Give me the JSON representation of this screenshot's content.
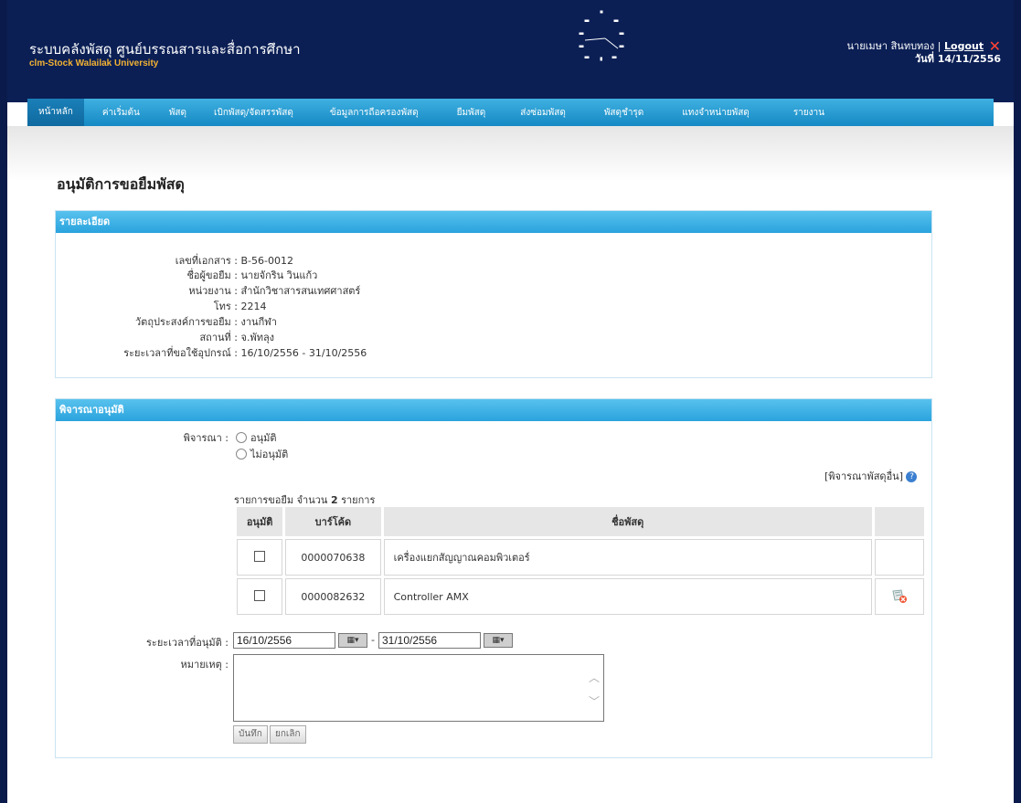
{
  "header": {
    "site_title": "ระบบคลังพัสดุ ศูนย์บรรณสารและสื่อการศึกษา",
    "site_subtitle": "clm-Stock Walailak University",
    "user_name": "นายเมษา สินทบทอง |",
    "logout_label": "Logout",
    "date_label": "วันที่ 14/11/2556"
  },
  "nav": {
    "items": [
      {
        "label": "หน้าหลัก"
      },
      {
        "label": "ค่าเริ่มต้น"
      },
      {
        "label": "พัสดุ"
      },
      {
        "label": "เบิกพัสดุ/จัดสรรพัสดุ"
      },
      {
        "label": "ข้อมูลการถือครองพัสดุ"
      },
      {
        "label": "ยืมพัสดุ"
      },
      {
        "label": "ส่งซ่อมพัสดุ"
      },
      {
        "label": "พัสดุชำรุด"
      },
      {
        "label": "แทงจำหน่ายพัสดุ"
      },
      {
        "label": "รายงาน"
      }
    ]
  },
  "page": {
    "title": "อนุมัติการขอยืมพัสดุ"
  },
  "details": {
    "panel_title": "รายละเอียด",
    "rows": [
      {
        "label": "เลขที่เอกสาร :",
        "value": "B-56-0012"
      },
      {
        "label": "ชื่อผู้ขอยืม :",
        "value": "นายจักริน วินแก้ว"
      },
      {
        "label": "หน่วยงาน :",
        "value": "สำนักวิชาสารสนเทศศาสตร์"
      },
      {
        "label": "โทร :",
        "value": "2214"
      },
      {
        "label": "วัตถุประสงค์การขอยืม :",
        "value": "งานกีฬา"
      },
      {
        "label": "สถานที่ :",
        "value": "จ.พัทลุง"
      },
      {
        "label": "ระยะเวลาที่ขอใช้อุปกรณ์ :",
        "value": "16/10/2556 - 31/10/2556"
      }
    ]
  },
  "approval": {
    "panel_title": "พิจารณาอนุมัติ",
    "consider_label": "พิจารณา :",
    "option_approve": "อนุมัติ",
    "option_reject": "ไม่อนุมัติ",
    "other_link": "[พิจารณาพัสดุอื่น]",
    "item_count_text": "รายการขอยืม จำนวน",
    "item_count": "2",
    "item_count_unit": "รายการ",
    "table_headers": {
      "approve": "อนุมัติ",
      "barcode": "บาร์โค้ด",
      "name": "ชื่อพัสดุ"
    },
    "items": [
      {
        "barcode": "0000070638",
        "name": "เครื่องแยกสัญญาณคอมพิวเตอร์"
      },
      {
        "barcode": "0000082632",
        "name": "Controller AMX"
      }
    ],
    "period_label": "ระยะเวลาที่อนุมัติ :",
    "date_from": "16/10/2556",
    "date_separator": "-",
    "date_to": "31/10/2556",
    "note_label": "หมายเหตุ :",
    "save_label": "บันทึก",
    "cancel_label": "ยกเลิก"
  },
  "colors": {
    "header_bg": "#0b1f55",
    "nav_bg": "#1f9ad4",
    "panel_head": "#3bb0e4",
    "subtitle": "#f2b233"
  }
}
